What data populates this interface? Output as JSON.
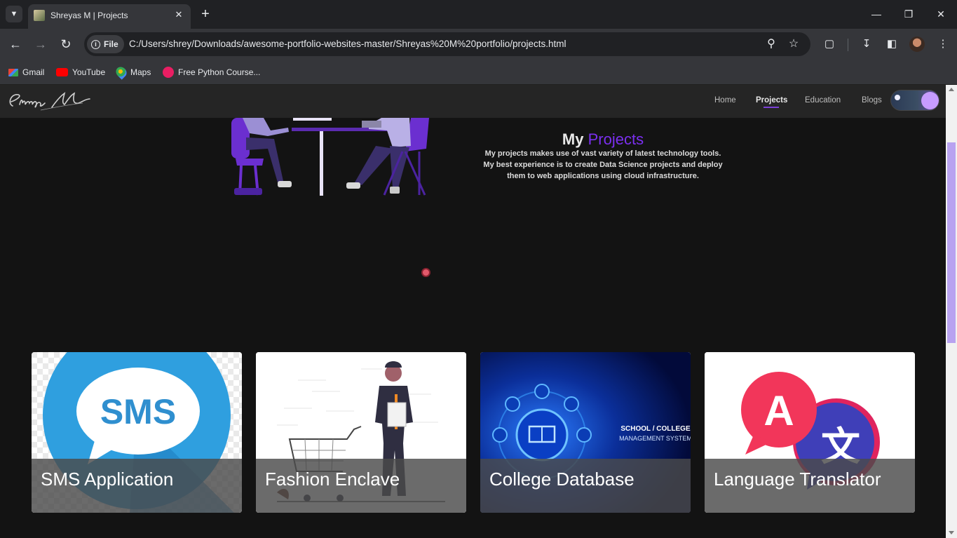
{
  "browser": {
    "tab_title": "Shreyas M | Projects",
    "url_chip": "File",
    "url": "C:/Users/shrey/Downloads/awesome-portfolio-websites-master/Shreyas%20M%20portfolio/projects.html",
    "bookmarks": [
      {
        "label": "Gmail",
        "icon": "gmail-icon",
        "color": "#ea4335"
      },
      {
        "label": "YouTube",
        "icon": "youtube-icon",
        "color": "#ff0000"
      },
      {
        "label": "Maps",
        "icon": "maps-icon",
        "color": "#34a853"
      },
      {
        "label": "Free Python Course...",
        "icon": "course-icon",
        "color": "#e91e63"
      }
    ]
  },
  "site": {
    "logo_text": "Shreyas M",
    "nav": [
      {
        "label": "Home",
        "active": false
      },
      {
        "label": "Projects",
        "active": true
      },
      {
        "label": "Education",
        "active": false
      },
      {
        "label": "Blogs",
        "active": false
      }
    ],
    "accent_color": "#7b2ff0"
  },
  "hero": {
    "title_plain": "My",
    "title_accent": "Projects",
    "description_lines": [
      "My projects makes use of vast variety of latest technology tools.",
      "My best experience is to create Data Science projects and deploy",
      "them to web applications using cloud infrastructure."
    ]
  },
  "projects": [
    {
      "title": "SMS Application",
      "art_text": "SMS"
    },
    {
      "title": "Fashion Enclave",
      "art_text": ""
    },
    {
      "title": "College Database",
      "art_text": "SCHOOL / COLLEGE",
      "art_text2": "MANAGEMENT SYSTEM"
    },
    {
      "title": "Language Translator",
      "art_text": "A",
      "art_text2": "文"
    }
  ]
}
